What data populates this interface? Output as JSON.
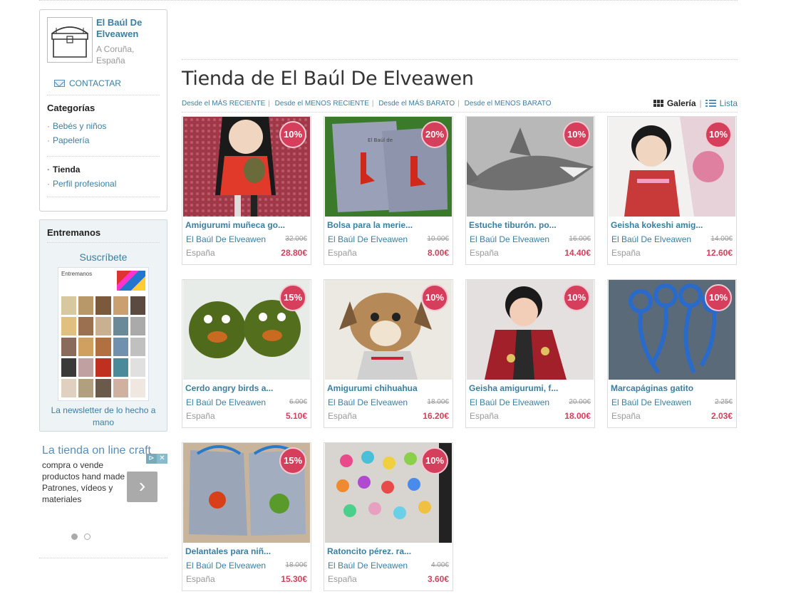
{
  "shop": {
    "name": "El Baúl De Elveawen",
    "location": "A Coruña, España",
    "logo_text": "Elveawen",
    "contact_label": "CONTACTAR"
  },
  "sidebar": {
    "categories_title": "Categorías",
    "categories": [
      "Bebés y niños",
      "Papelería"
    ],
    "nav": [
      {
        "label": "Tienda",
        "active": true
      },
      {
        "label": "Perfil profesional",
        "active": false
      }
    ]
  },
  "newsletter": {
    "title": "Entremanos",
    "subscribe_label": "Suscríbete",
    "thumb_word": "Entremanos",
    "caption": "La newsletter de lo hecho a mano"
  },
  "ad": {
    "title": "La tienda on line craft",
    "text": "compra o vende productos hand made Patrones, vídeos y materiales",
    "next_glyph": "›",
    "info_glyph": "⊳",
    "close_glyph": "✕"
  },
  "main": {
    "title": "Tienda de El Baúl De Elveawen",
    "sorts": [
      "Desde el MÁS RECIENTE",
      "Desde el MENOS RECIENTE",
      "Desde el MÁS BARATO",
      "Desde el MENOS BARATO"
    ],
    "view_gallery": "Galería",
    "view_list": "Lista"
  },
  "products": [
    {
      "name": "Amigurumi muñeca go...",
      "seller": "El Baúl De Elveawen",
      "old_price": "32.00€",
      "country": "España",
      "price": "28.80€",
      "discount": "10%"
    },
    {
      "name": "Bolsa para la merie...",
      "seller": "El Baúl De Elveawen",
      "old_price": "10.00€",
      "country": "España",
      "price": "8.00€",
      "discount": "20%"
    },
    {
      "name": "Estuche tiburón. po...",
      "seller": "El Baúl De Elveawen",
      "old_price": "16.00€",
      "country": "España",
      "price": "14.40€",
      "discount": "10%"
    },
    {
      "name": "Geisha kokeshi amig...",
      "seller": "El Baúl De Elveawen",
      "old_price": "14.00€",
      "country": "España",
      "price": "12.60€",
      "discount": "10%"
    },
    {
      "name": "Cerdo angry birds a...",
      "seller": "El Baúl De Elveawen",
      "old_price": "6.00€",
      "country": "España",
      "price": "5.10€",
      "discount": "15%"
    },
    {
      "name": "Amigurumi chihuahua",
      "seller": "El Baúl De Elveawen",
      "old_price": "18.00€",
      "country": "España",
      "price": "16.20€",
      "discount": "10%"
    },
    {
      "name": "Geisha amigurumi, f...",
      "seller": "El Baúl De Elveawen",
      "old_price": "20.00€",
      "country": "España",
      "price": "18.00€",
      "discount": "10%"
    },
    {
      "name": "Marcapáginas gatito",
      "seller": "El Baúl De Elveawen",
      "old_price": "2.25€",
      "country": "España",
      "price": "2.03€",
      "discount": "10%"
    },
    {
      "name": "Delantales para niñ...",
      "seller": "El Baúl De Elveawen",
      "old_price": "18.00€",
      "country": "España",
      "price": "15.30€",
      "discount": "15%"
    },
    {
      "name": "Ratoncito pérez. ra...",
      "seller": "El Baúl De Elveawen",
      "old_price": "4.00€",
      "country": "España",
      "price": "3.60€",
      "discount": "10%"
    }
  ],
  "colors": {
    "link": "#3a7fa0",
    "sale": "#d53f5c",
    "muted": "#999999"
  }
}
